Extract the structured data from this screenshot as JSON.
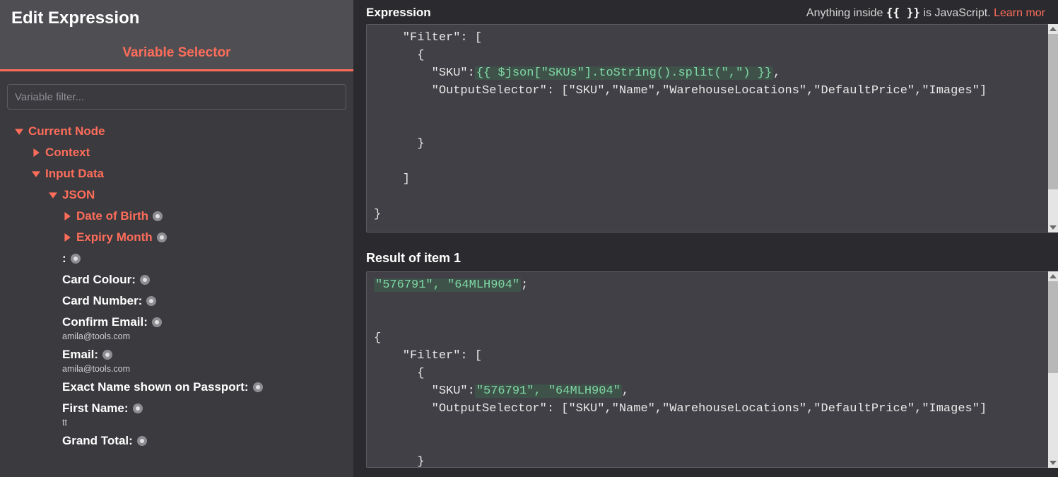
{
  "left": {
    "title": "Edit Expression",
    "tab": "Variable Selector",
    "filter_placeholder": "Variable filter...",
    "tree": {
      "current_node": "Current Node",
      "context": "Context",
      "input_data": "Input Data",
      "json": "JSON",
      "leaf_dob": "Date of Birth",
      "leaf_expiry": "Expiry Month",
      "leaf_colon": ":",
      "leaf_card_colour": "Card Colour:",
      "leaf_card_number": "Card Number:",
      "leaf_confirm_email": "Confirm Email:",
      "val_confirm_email": "amila@tools.com",
      "leaf_email": "Email:",
      "val_email": "amila@tools.com",
      "leaf_passport": "Exact Name shown on Passport:",
      "leaf_first_name": "First Name:",
      "val_first_name": "tt",
      "leaf_grand_total": "Grand Total:"
    }
  },
  "right": {
    "expression_title": "Expression",
    "hint_prefix": "Anything inside ",
    "hint_braces": "{{ }}",
    "hint_suffix": " is JavaScript. ",
    "hint_link": "Learn mor",
    "expression_code": {
      "l1": "    \"Filter\": [",
      "l2": "      {",
      "l3a": "        \"SKU\":",
      "l3b": "{{ $json[\"SKUs\"].toString().split(\",\") }}",
      "l3c": ",",
      "l4": "        \"OutputSelector\": [\"SKU\",\"Name\",\"WarehouseLocations\",\"DefaultPrice\",\"Images\"]",
      "l5": "",
      "l6": "",
      "l7": "      }",
      "l8": "",
      "l9": "    ]",
      "l10": "",
      "l11": "}"
    },
    "result_title": "Result of item 1",
    "result_code": {
      "l1a": "\"576791\", \"64MLH904\"",
      "l1b": ";",
      "l2": "",
      "l3": "",
      "l4": "{",
      "l5": "    \"Filter\": [",
      "l6": "      {",
      "l7a": "        \"SKU\":",
      "l7b": "\"576791\", \"64MLH904\"",
      "l7c": ",",
      "l8": "        \"OutputSelector\": [\"SKU\",\"Name\",\"WarehouseLocations\",\"DefaultPrice\",\"Images\"]",
      "l9": "",
      "l10": "",
      "l11": "      }"
    }
  }
}
